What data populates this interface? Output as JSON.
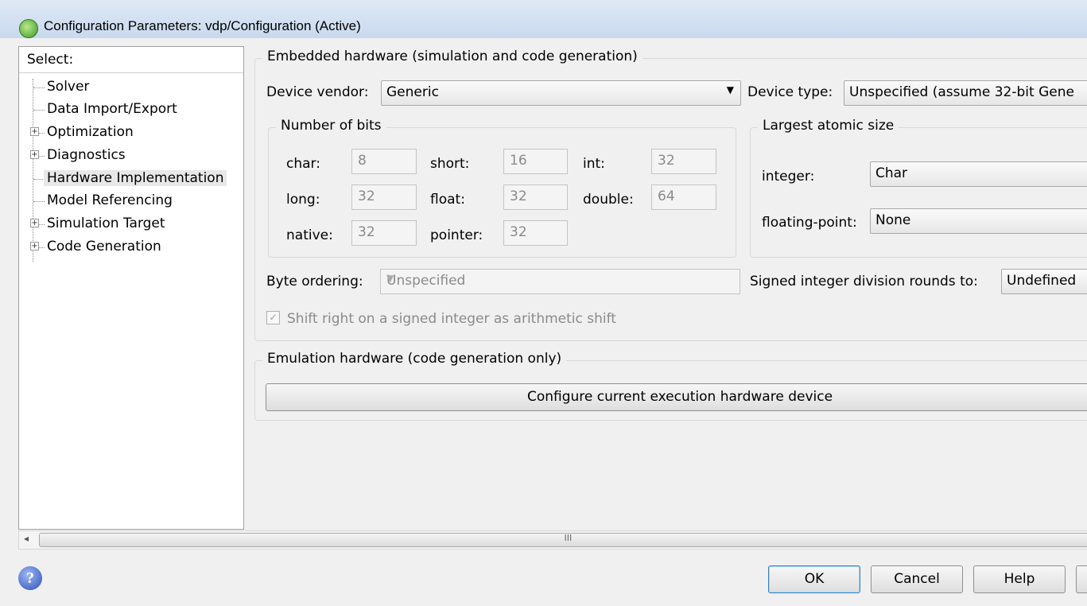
{
  "window": {
    "title": "Configuration Parameters: vdp/Configuration (Active)"
  },
  "tree": {
    "header": "Select:",
    "items": [
      {
        "label": "Solver",
        "expandable": false
      },
      {
        "label": "Data Import/Export",
        "expandable": false
      },
      {
        "label": "Optimization",
        "expandable": true
      },
      {
        "label": "Diagnostics",
        "expandable": true
      },
      {
        "label": "Hardware Implementation",
        "expandable": false,
        "selected": true
      },
      {
        "label": "Model Referencing",
        "expandable": false
      },
      {
        "label": "Simulation Target",
        "expandable": true
      },
      {
        "label": "Code Generation",
        "expandable": true
      }
    ]
  },
  "embedded": {
    "legend": "Embedded hardware (simulation and code generation)",
    "device_vendor_label": "Device vendor:",
    "device_vendor_value": "Generic",
    "device_type_label": "Device type:",
    "device_type_value": "Unspecified (assume 32-bit Gene",
    "bits": {
      "legend": "Number of bits",
      "char_label": "char:",
      "char_value": "8",
      "short_label": "short:",
      "short_value": "16",
      "int_label": "int:",
      "int_value": "32",
      "long_label": "long:",
      "long_value": "32",
      "float_label": "float:",
      "float_value": "32",
      "double_label": "double:",
      "double_value": "64",
      "native_label": "native:",
      "native_value": "32",
      "pointer_label": "pointer:",
      "pointer_value": "32"
    },
    "atomic": {
      "legend": "Largest atomic size",
      "integer_label": "integer:",
      "integer_value": "Char",
      "float_label": "floating-point:",
      "float_value": "None"
    },
    "byte_ordering_label": "Byte ordering:",
    "byte_ordering_value": "Unspecified",
    "signed_div_label": "Signed integer division rounds to:",
    "signed_div_value": "Undefined",
    "shift_label": "Shift right on a signed integer as arithmetic shift",
    "shift_checked": true
  },
  "emulation": {
    "legend": "Emulation hardware (code generation only)",
    "configure_button": "Configure current execution hardware device"
  },
  "scrollbar": {
    "left_arrow": "◂",
    "grip": "III"
  },
  "footer": {
    "ok": "OK",
    "cancel": "Cancel",
    "help": "Help",
    "help_icon": "?"
  },
  "colors": {
    "window_bg": "#f0f0f0",
    "title_gradient": "#c9d9ee",
    "default_button_border": "#3c7fb1"
  }
}
